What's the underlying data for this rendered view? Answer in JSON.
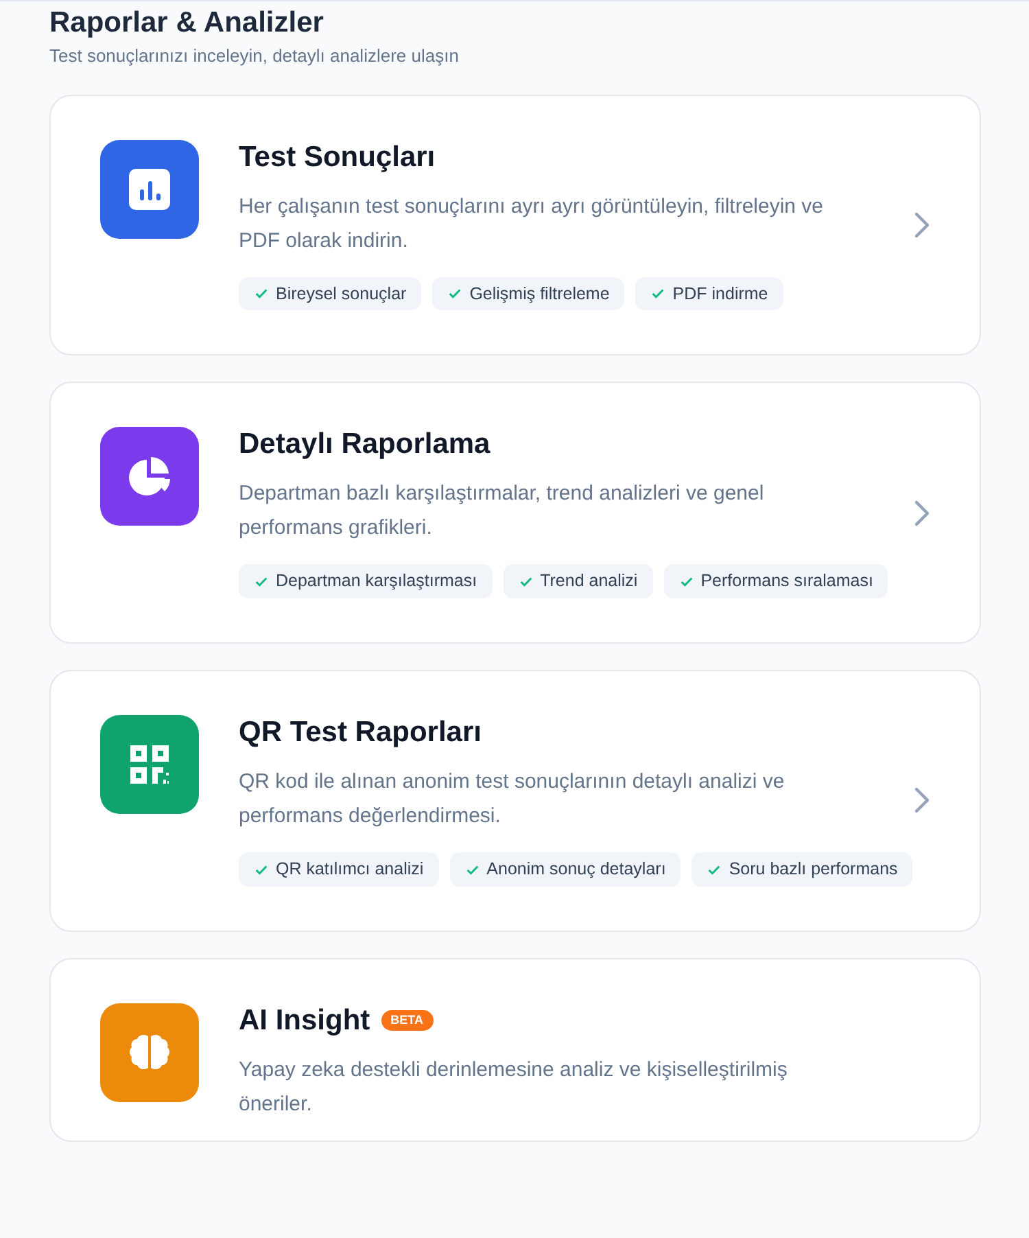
{
  "header": {
    "title": "Raporlar & Analizler",
    "subtitle": "Test sonuçlarınızı inceleyin, detaylı analizlere ulaşın"
  },
  "cards": [
    {
      "kind": "bar-chart",
      "color": "#2f66e6",
      "title": "Test Sonuçları",
      "description": "Her çalışanın test sonuçlarını ayrı ayrı görüntüleyin, filtreleyin ve PDF olarak indirin.",
      "features": [
        "Bireysel sonuçlar",
        "Gelişmiş filtreleme",
        "PDF indirme"
      ]
    },
    {
      "kind": "pie-chart",
      "color": "#7c3aed",
      "title": "Detaylı Raporlama",
      "description": "Departman bazlı karşılaştırmalar, trend analizleri ve genel performans grafikleri.",
      "features": [
        "Departman karşılaştırması",
        "Trend analizi",
        "Performans sıralaması"
      ]
    },
    {
      "kind": "qr",
      "color": "#10a36e",
      "title": "QR Test Raporları",
      "description": "QR kod ile alınan anonim test sonuçlarının detaylı analizi ve performans değerlendirmesi.",
      "features": [
        "QR katılımcı analizi",
        "Anonim sonuç detayları",
        "Soru bazlı performans"
      ]
    },
    {
      "kind": "brain",
      "color": "#ec8a0c",
      "title": "AI Insight",
      "badge": "BETA",
      "description": "Yapay zeka destekli derinlemesine analiz ve kişiselleştirilmiş öneriler."
    }
  ]
}
